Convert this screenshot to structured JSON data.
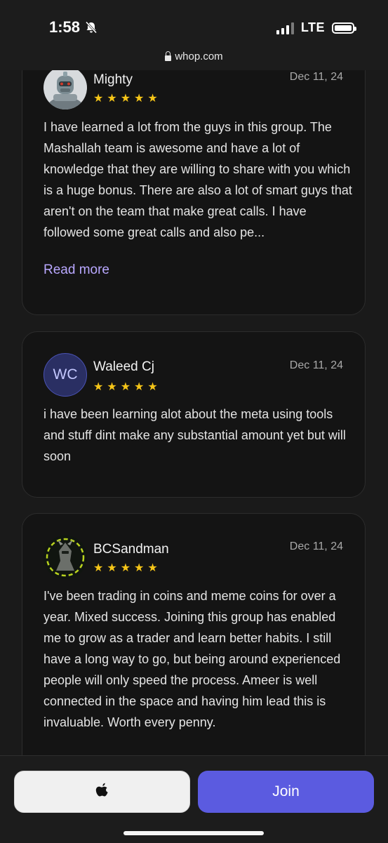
{
  "status_bar": {
    "time": "1:58",
    "network": "LTE",
    "url": "whop.com"
  },
  "reviews": [
    {
      "name": "Mighty",
      "date": "Dec 11, 24",
      "rating": 5,
      "avatar_type": "image",
      "text": "I have learned a lot from the guys in this group. The Mashallah team is awesome and have a lot of knowledge that they are willing to share with you which is a huge bonus. There are also a lot of smart guys that aren't on the team that make great calls. I have followed some great calls and also pe...",
      "read_more": "Read more"
    },
    {
      "name": "Waleed Cj",
      "date": "Dec 11, 24",
      "rating": 5,
      "avatar_type": "initials",
      "initials": "WC",
      "text": "i have been learning alot about the meta using tools and stuff dint make any substantial amount yet but will soon"
    },
    {
      "name": "BCSandman",
      "date": "Dec 11, 24",
      "rating": 5,
      "avatar_type": "image",
      "text": "I've been trading in coins and meme coins for over a year. Mixed success. Joining this group has enabled me to grow as a trader and learn better habits. I still have a long way to go, but being around experienced people will only speed the process. Ameer is well connected in the space and having him lead this is invaluable. Worth every penny."
    }
  ],
  "actions": {
    "apple_icon": "apple-icon",
    "join_label": "Join"
  },
  "colors": {
    "accent": "#5b5be0",
    "star": "#f5c518",
    "link": "#b9a8ff"
  }
}
